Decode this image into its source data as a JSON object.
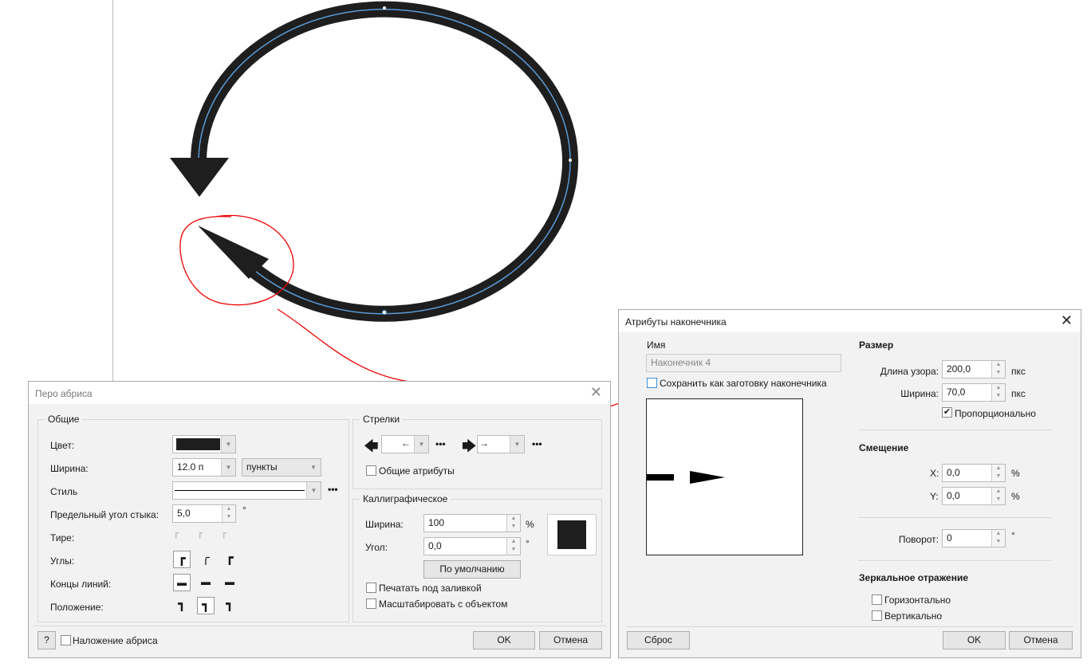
{
  "outline_pen": {
    "title": "Перо абриса",
    "general": {
      "legend": "Общие",
      "color_label": "Цвет:",
      "color_value": "#1e1e1e",
      "width_label": "Ширина:",
      "width_value": "12.0 п",
      "units_value": "пункты",
      "style_label": "Стиль",
      "miter_label": "Предельный угол стыка:",
      "miter_value": "5,0",
      "miter_unit": "°",
      "dash_label": "Тире:",
      "corners_label": "Углы:",
      "caps_label": "Концы линий:",
      "position_label": "Положение:"
    },
    "arrows": {
      "legend": "Стрелки",
      "shared_attrs": "Общие атрибуты"
    },
    "calligraphic": {
      "legend": "Каллиграфическое",
      "width_label": "Ширина:",
      "width_value": "100",
      "width_unit": "%",
      "angle_label": "Угол:",
      "angle_value": "0,0",
      "angle_unit": "°",
      "default_button": "По умолчанию",
      "behind_fill": "Печатать под заливкой",
      "scale_with_object": "Масштабировать с объектом"
    },
    "help": "?",
    "overprint": "Наложение абриса",
    "ok": "OK",
    "cancel": "Отмена"
  },
  "arrow_attrs": {
    "title": "Атрибуты наконечника",
    "name_label": "Имя",
    "name_value": "Наконечник 4",
    "save_preset": "Сохранить как заготовку наконечника",
    "size_header": "Размер",
    "length_label": "Длина узора:",
    "length_value": "200,0",
    "length_unit": "пкс",
    "width_label": "Ширина:",
    "width_value": "70,0",
    "width_unit": "пкс",
    "proportional": "Пропорционально",
    "offset_header": "Смещение",
    "x_label": "X:",
    "x_value": "0,0",
    "y_label": "Y:",
    "y_value": "0,0",
    "pct": "%",
    "rotation_label": "Поворот:",
    "rotation_value": "0",
    "rotation_unit": "°",
    "mirror_header": "Зеркальное отражение",
    "horizontal": "Горизонтально",
    "vertical": "Вертикально",
    "reset": "Сброс",
    "ok": "OK",
    "cancel": "Отмена"
  }
}
